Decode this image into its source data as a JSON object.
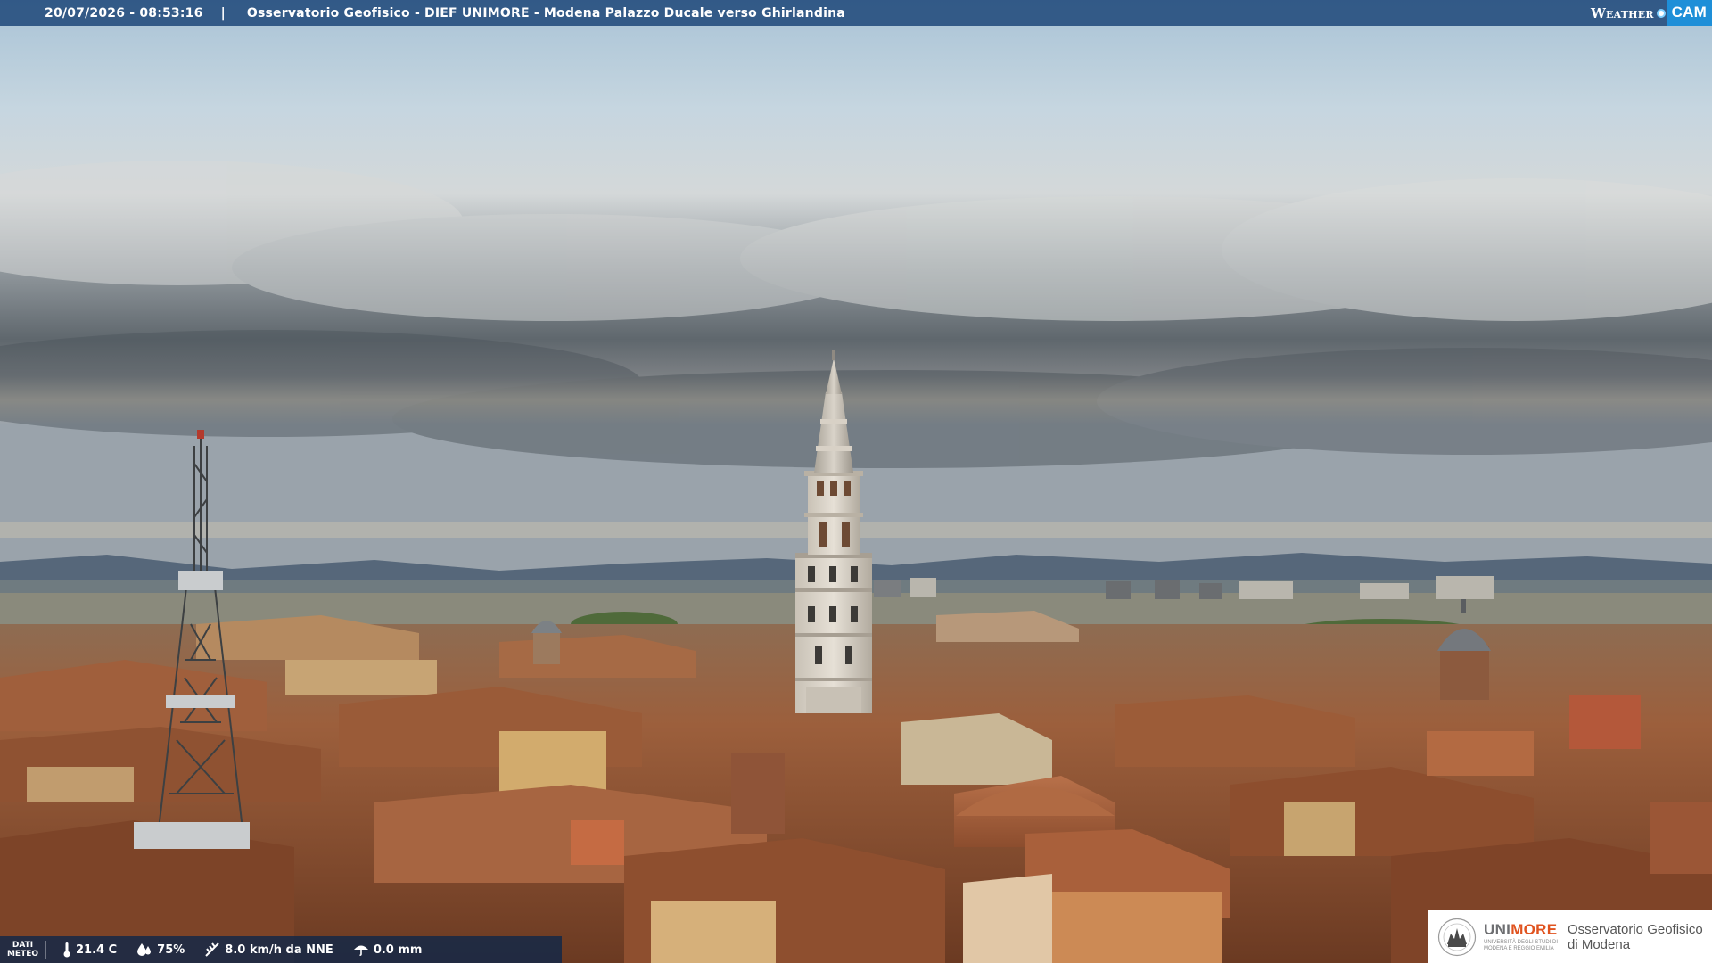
{
  "header": {
    "timestamp": "20/07/2026 - 08:53:16",
    "separator": "|",
    "title": "Osservatorio Geofisico - DIEF UNIMORE - Modena Palazzo Ducale verso Ghirlandina",
    "brand_weather": "Weather",
    "brand_cam": "CAM"
  },
  "weather": {
    "label_line1": "DATI",
    "label_line2": "METEO",
    "temperature": "21.4 C",
    "humidity": "75%",
    "wind": "8.0 km/h da NNE",
    "rain": "0.0 mm"
  },
  "logo": {
    "uni_part1": "UNI",
    "uni_part2": "MORE",
    "uni_subtitle": "Università degli studi di Modena e Reggio Emilia",
    "observatory_line1": "Osservatorio Geofisico",
    "observatory_line2": "di Modena"
  },
  "colors": {
    "topbar": "#285080",
    "cam_accent": "#1e8fd8",
    "unimore_orange": "#e0531f"
  },
  "icons": {
    "temperature": "thermometer-icon",
    "humidity": "droplet-icon",
    "wind": "wind-icon",
    "rain": "rain-icon"
  }
}
